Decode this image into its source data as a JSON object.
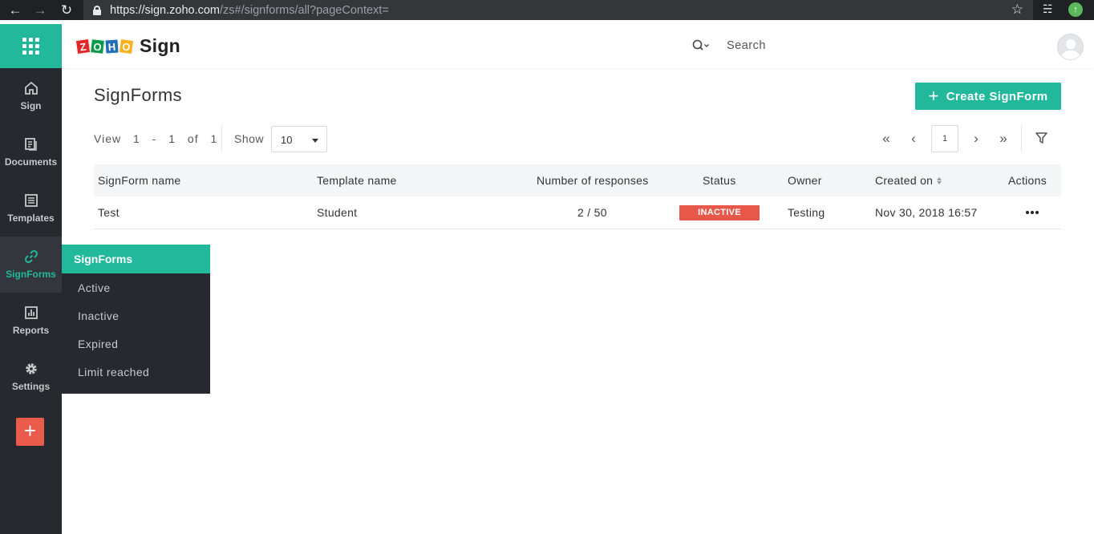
{
  "browser": {
    "url_host": "https://sign.zoho.com",
    "url_path": "/zs#/signforms/all?pageContext="
  },
  "app": {
    "brand_word": "ZOHO",
    "product_name": "Sign",
    "search_placeholder": "Search"
  },
  "sidebar": {
    "items": [
      {
        "label": "Sign",
        "icon": "home-icon"
      },
      {
        "label": "Documents",
        "icon": "documents-icon"
      },
      {
        "label": "Templates",
        "icon": "templates-icon"
      },
      {
        "label": "SignForms",
        "icon": "link-icon",
        "active": true
      },
      {
        "label": "Reports",
        "icon": "reports-icon"
      },
      {
        "label": "Settings",
        "icon": "gear-icon"
      }
    ],
    "add_label": "+"
  },
  "submenu": {
    "title": "SignForms",
    "items": [
      "Active",
      "Inactive",
      "Expired",
      "Limit reached"
    ]
  },
  "page": {
    "title": "SignForms",
    "create_button": "Create SignForm"
  },
  "toolbar": {
    "view_label": "View",
    "range_start": "1",
    "range_dash": "-",
    "range_end": "1",
    "of_label": "of",
    "total": "1",
    "show_label": "Show",
    "page_size": "10",
    "current_page": "1"
  },
  "table": {
    "columns": [
      "SignForm name",
      "Template name",
      "Number of responses",
      "Status",
      "Owner",
      "Created on",
      "Actions"
    ],
    "rows": [
      {
        "name": "Test",
        "template": "Student",
        "responses": "2 / 50",
        "status": "INACTIVE",
        "owner": "Testing",
        "created": "Nov 30, 2018 16:57"
      }
    ]
  },
  "colors": {
    "accent": "#22b89b",
    "sidebar_bg": "#26292e",
    "inactive_badge": "#e8584a",
    "add_button": "#ea5b4c"
  }
}
